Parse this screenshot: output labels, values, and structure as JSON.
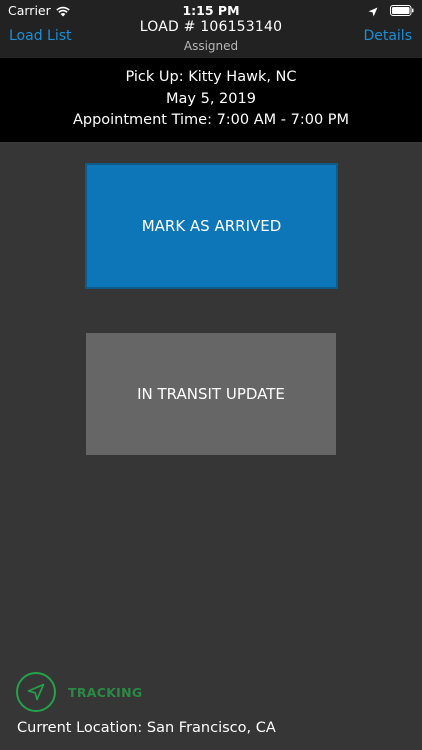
{
  "status_bar": {
    "carrier": "Carrier",
    "time": "1:15 PM"
  },
  "nav": {
    "back_label": "Load List",
    "title": "LOAD # 106153140",
    "subtitle": "Assigned",
    "details_label": "Details"
  },
  "info": {
    "pickup": "Pick Up: Kitty Hawk, NC",
    "date": "May 5, 2019",
    "appointment": "Appointment Time: 7:00 AM - 7:00 PM"
  },
  "actions": {
    "arrived_label": "MARK AS ARRIVED",
    "transit_label": "IN TRANSIT UPDATE"
  },
  "tracking": {
    "label": "TRACKING",
    "icon": "navigation-arrow-icon",
    "current_location": "Current Location: San Francisco, CA"
  },
  "colors": {
    "accent": "#1d8fd6",
    "primary_button": "#0c76b8",
    "secondary_button": "#666666",
    "tracking_green": "#24a24a",
    "background": "#363636"
  }
}
